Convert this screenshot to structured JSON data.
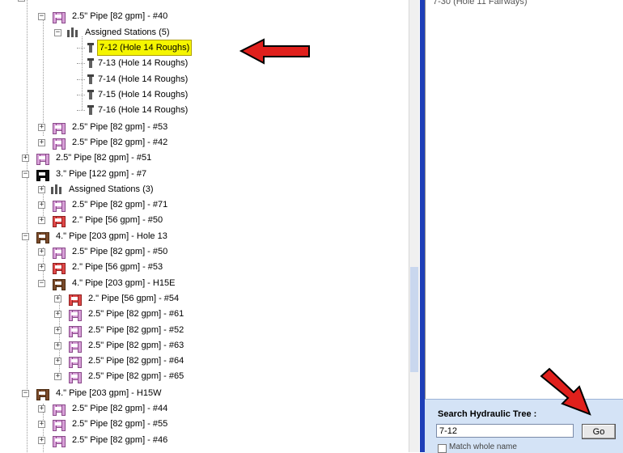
{
  "tree": {
    "rows": [
      {
        "text": "2.5\" Pipe [82 gpm] - #40",
        "icon": "pipe-pink-icon",
        "expander": "−"
      },
      {
        "text": "Assigned Stations (5)",
        "icon": "assigned-stations-icon",
        "expander": "−"
      },
      {
        "text": "7-12  (Hole 14 Roughs)",
        "icon": "sprinkler-station-icon",
        "highlighted": true
      },
      {
        "text": "7-13  (Hole 14 Roughs)",
        "icon": "sprinkler-station-icon"
      },
      {
        "text": "7-14  (Hole 14 Roughs)",
        "icon": "sprinkler-station-icon"
      },
      {
        "text": "7-15  (Hole 14 Roughs)",
        "icon": "sprinkler-station-icon"
      },
      {
        "text": "7-16  (Hole 14 Roughs)",
        "icon": "sprinkler-station-icon"
      },
      {
        "text": "2.5\" Pipe [82 gpm] - #53",
        "icon": "pipe-pink-icon",
        "expander": "+"
      },
      {
        "text": "2.5\" Pipe [82 gpm] - #42",
        "icon": "pipe-pink-icon",
        "expander": "+"
      },
      {
        "text": "2.5\" Pipe [82 gpm] - #51",
        "icon": "pipe-pink-icon",
        "expander": "+"
      },
      {
        "text": "3.\" Pipe [122 gpm] - #7",
        "icon": "pipe-black-icon",
        "expander": "−"
      },
      {
        "text": "Assigned Stations (3)",
        "icon": "assigned-stations-icon",
        "expander": "+"
      },
      {
        "text": "2.5\" Pipe [82 gpm] - #71",
        "icon": "pipe-pink-icon",
        "expander": "+"
      },
      {
        "text": "2.\" Pipe [56 gpm] - #50",
        "icon": "pipe-red-icon",
        "expander": "+"
      },
      {
        "text": "4.\" Pipe [203 gpm] - Hole 13",
        "icon": "pipe-brown-icon",
        "expander": "−"
      },
      {
        "text": "2.5\" Pipe [82 gpm] - #50",
        "icon": "pipe-pink-icon",
        "expander": "+"
      },
      {
        "text": "2.\" Pipe [56 gpm] - #53",
        "icon": "pipe-red-icon",
        "expander": "+"
      },
      {
        "text": "4.\" Pipe [203 gpm] - H15E",
        "icon": "pipe-brown-icon",
        "expander": "−"
      },
      {
        "text": "2.\" Pipe [56 gpm] - #54",
        "icon": "pipe-red-icon",
        "expander": "+"
      },
      {
        "text": "2.5\" Pipe [82 gpm] - #61",
        "icon": "pipe-pink-icon",
        "expander": "+"
      },
      {
        "text": "2.5\" Pipe [82 gpm] - #52",
        "icon": "pipe-pink-icon",
        "expander": "+"
      },
      {
        "text": "2.5\" Pipe [82 gpm] - #63",
        "icon": "pipe-pink-icon",
        "expander": "+"
      },
      {
        "text": "2.5\" Pipe [82 gpm] - #64",
        "icon": "pipe-pink-icon",
        "expander": "+"
      },
      {
        "text": "2.5\" Pipe [82 gpm] - #65",
        "icon": "pipe-pink-icon",
        "expander": "+"
      },
      {
        "text": "4.\" Pipe [203 gpm] - H15W",
        "icon": "pipe-brown-icon",
        "expander": "−"
      },
      {
        "text": "2.5\" Pipe [82 gpm] - #44",
        "icon": "pipe-pink-icon",
        "expander": "+"
      },
      {
        "text": "2.5\" Pipe [82 gpm] - #55",
        "icon": "pipe-pink-icon",
        "expander": "+"
      },
      {
        "text": "2.5\" Pipe [82 gpm] - #46",
        "icon": "pipe-pink-icon",
        "expander": "+"
      }
    ]
  },
  "right_panel": {
    "partial_top_text": "7-30  (Hole 11 Fairways)"
  },
  "search": {
    "title": "Search Hydraulic Tree :",
    "input_value": "7-12",
    "go_label": "Go",
    "checkbox_label": "Match whole name"
  },
  "colors": {
    "highlight": "#f5f500",
    "annotation_arrow": "#e0201c",
    "divider": "#1e3fb8",
    "search_panel_bg": "#d4e3f6"
  }
}
